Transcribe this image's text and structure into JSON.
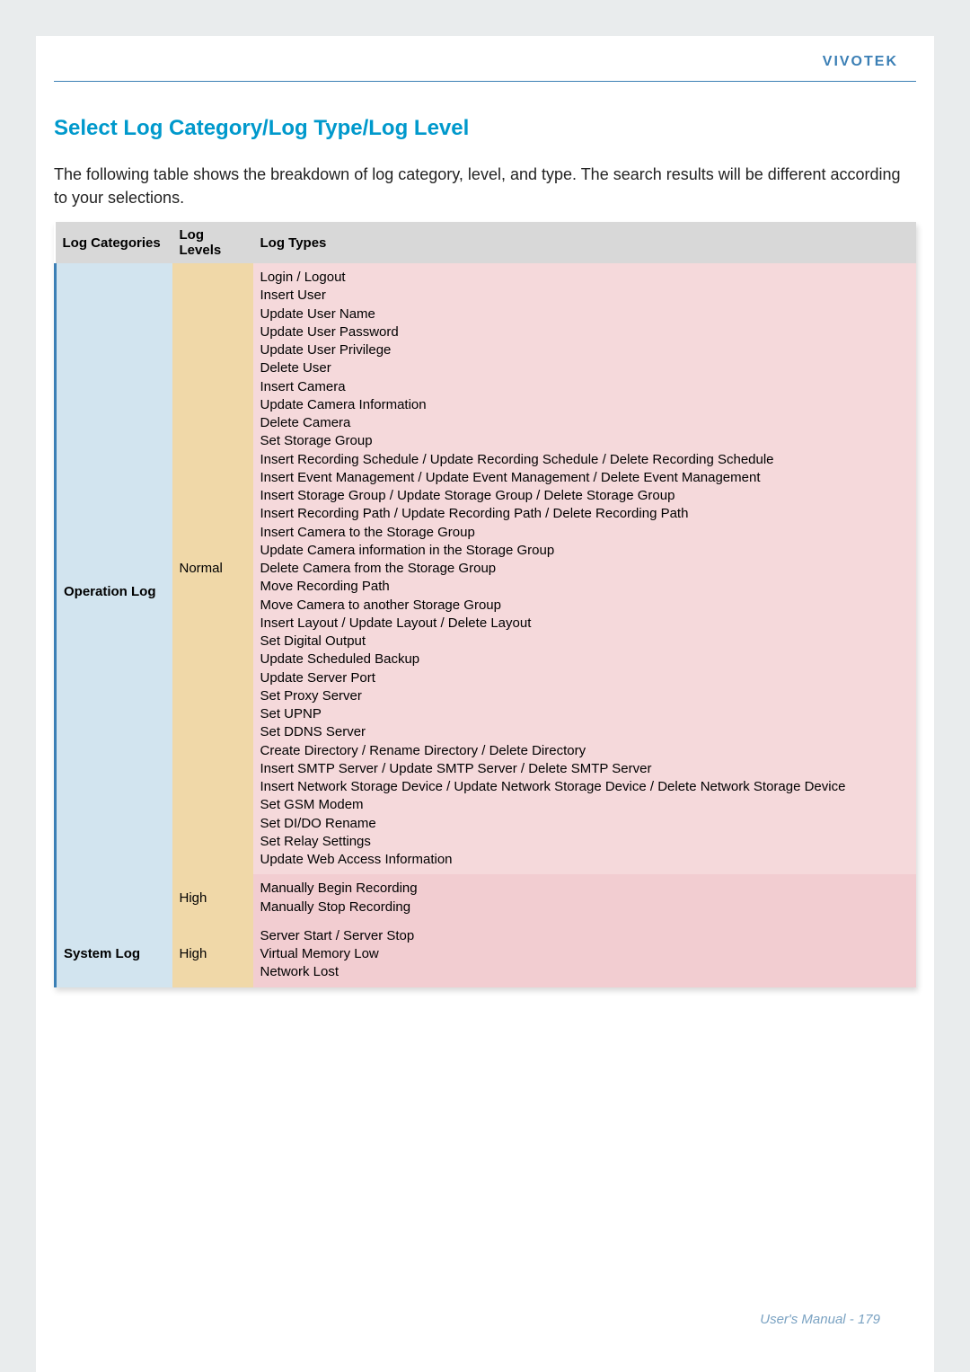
{
  "brand": "VIVOTEK",
  "section_title": "Select Log Category/Log Type/Log Level",
  "intro": "The following table shows the breakdown of log category, level, and type. The search results will be different according to your selections.",
  "headers": {
    "categories": "Log Categories",
    "levels": "Log Levels",
    "types": "Log Types"
  },
  "rows": [
    {
      "category": "Operation Log",
      "entries": [
        {
          "level": "Normal",
          "types": [
            "Login / Logout",
            "Insert User",
            "Update User Name",
            "Update User Password",
            "Update User Privilege",
            "Delete User",
            "Insert Camera",
            "Update Camera Information",
            "Delete Camera",
            "Set Storage Group",
            "Insert Recording Schedule / Update Recording Schedule / Delete Recording Schedule",
            "Insert Event Management / Update Event Management / Delete Event Management",
            "Insert Storage Group / Update Storage Group / Delete Storage Group",
            "Insert Recording Path / Update Recording Path / Delete Recording Path",
            "Insert Camera to the Storage Group",
            "Update Camera information in the Storage Group",
            "Delete Camera from the Storage Group",
            "Move Recording Path",
            "Move Camera to another Storage Group",
            "Insert Layout / Update Layout / Delete Layout",
            "Set Digital Output",
            "Update Scheduled Backup",
            "Update Server Port",
            "Set Proxy Server",
            "Set UPNP",
            "Set DDNS Server",
            "Create Directory / Rename Directory / Delete Directory",
            "Insert SMTP Server / Update SMTP Server / Delete SMTP Server",
            "Insert Network Storage Device / Update Network Storage Device / Delete Network Storage Device",
            "Set GSM Modem",
            "Set DI/DO Rename",
            "Set Relay Settings",
            "Update Web Access Information"
          ]
        },
        {
          "level": "High",
          "types": [
            "Manually Begin Recording",
            "Manually Stop Recording"
          ]
        }
      ]
    },
    {
      "category": "System Log",
      "entries": [
        {
          "level": "High",
          "types": [
            "Server Start / Server Stop",
            "Virtual Memory Low",
            "Network Lost"
          ]
        }
      ]
    }
  ],
  "footer": "User's Manual - 179"
}
